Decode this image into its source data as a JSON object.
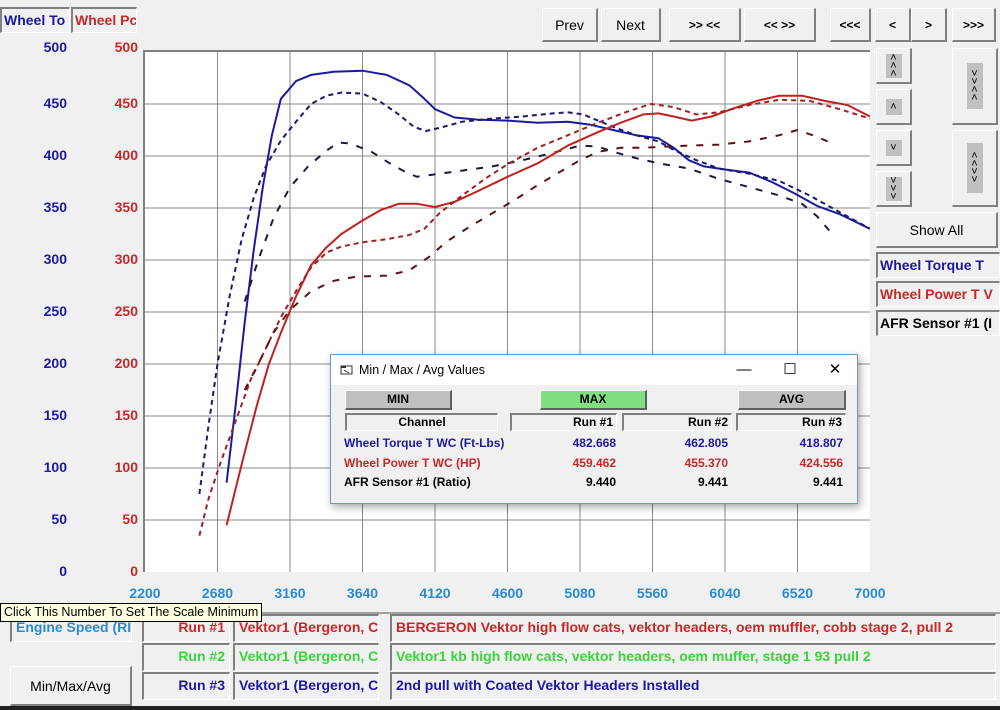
{
  "top_tabs": {
    "torque_channel": "Wheel To",
    "power_channel": "Wheel Pc"
  },
  "nav_buttons": {
    "prev": "Prev",
    "next": "Next",
    "zoom_in": ">> <<",
    "zoom_out": "<< >>",
    "first": "<<<",
    "back": "<",
    "forward": ">",
    "last": ">>>"
  },
  "side_controls": {
    "scroll_up_fast": "scroll-up-fast",
    "scroll_up": "scroll-up",
    "scroll_down": "scroll-down",
    "scroll_down_fast": "scroll-down-fast",
    "expand": "expand-vertical",
    "compress": "compress-vertical",
    "show_all": "Show All"
  },
  "legend": [
    {
      "label": "Wheel Torque T",
      "color": "#1a1aa0"
    },
    {
      "label": "Wheel Power T V",
      "color": "#c82828"
    },
    {
      "label": "AFR Sensor #1 (I",
      "color": "#000000"
    }
  ],
  "tooltip": "Click This Number To Set The Scale Minimum",
  "x_channel": "Engine Speed (RI",
  "runs": [
    {
      "label": "Run #1",
      "file": "Vektor1 (Bergeron, C",
      "notes": "BERGERON Vektor high flow cats, vektor headers, oem muffler, cobb stage 2, pull 2",
      "color": "#c82828"
    },
    {
      "label": "Run #2",
      "file": "Vektor1 (Bergeron, C",
      "notes": "Vektor1 kb high flow cats, vektor headers, oem muffer, stage 1 93 pull 2",
      "color": "#3ad43a"
    },
    {
      "label": "Run #3",
      "file": "Vektor1 (Bergeron, C",
      "notes": "2nd pull with Coated Vektor Headers Installed",
      "color": "#1a1aa0"
    }
  ],
  "minmax_button": "Min/Max/Avg",
  "dialog": {
    "title": "Min / Max / Avg Values",
    "buttons": {
      "min": "MIN",
      "max": "MAX",
      "avg": "AVG"
    },
    "active": "MAX",
    "headers": [
      "Channel",
      "Run #1",
      "Run #2",
      "Run #3"
    ],
    "rows": [
      {
        "channel": "Wheel Torque T WC (Ft-Lbs)",
        "values": [
          "482.668",
          "462.805",
          "418.807"
        ],
        "color": "#1a1aa0"
      },
      {
        "channel": "Wheel Power T WC (HP)",
        "values": [
          "459.462",
          "455.370",
          "424.556"
        ],
        "color": "#c82828"
      },
      {
        "channel": "AFR Sensor #1 (Ratio)",
        "values": [
          "9.440",
          "9.441",
          "9.441"
        ],
        "color": "#000000"
      }
    ]
  },
  "chart_data": {
    "type": "line",
    "title": "",
    "xlabel": "Engine Speed (RPM)",
    "ylabel_left": "Wheel Torque T WC (Ft-Lbs)",
    "ylabel_right": "Wheel Power T WC (HP)",
    "xlim": [
      2200,
      7000
    ],
    "ylim": [
      0,
      500
    ],
    "x_ticks": [
      "2200",
      "2680",
      "3160",
      "3640",
      "4120",
      "4600",
      "5080",
      "5560",
      "6040",
      "6520",
      "7000"
    ],
    "y_ticks_torque": [
      "500",
      "450",
      "400",
      "350",
      "300",
      "250",
      "200",
      "150",
      "100",
      "50",
      "0"
    ],
    "y_ticks_power": [
      "500",
      "450",
      "400",
      "350",
      "300",
      "250",
      "200",
      "150",
      "100",
      "50",
      "0"
    ],
    "grid": true,
    "series": [
      {
        "name": "Wheel Torque Run #1",
        "color": "#1a1aa0",
        "style": "solid",
        "points": [
          [
            2740,
            86
          ],
          [
            2800,
            160
          ],
          [
            2860,
            240
          ],
          [
            2920,
            310
          ],
          [
            2980,
            370
          ],
          [
            3040,
            420
          ],
          [
            3100,
            455
          ],
          [
            3200,
            472
          ],
          [
            3300,
            478
          ],
          [
            3450,
            481
          ],
          [
            3640,
            482
          ],
          [
            3800,
            478
          ],
          [
            3950,
            468
          ],
          [
            4050,
            455
          ],
          [
            4120,
            445
          ],
          [
            4250,
            437
          ],
          [
            4400,
            435
          ],
          [
            4600,
            434
          ],
          [
            4800,
            432
          ],
          [
            5000,
            433
          ],
          [
            5150,
            430
          ],
          [
            5300,
            425
          ],
          [
            5450,
            420
          ],
          [
            5600,
            417
          ],
          [
            5700,
            408
          ],
          [
            5800,
            396
          ],
          [
            5900,
            390
          ],
          [
            6040,
            387
          ],
          [
            6200,
            384
          ],
          [
            6350,
            375
          ],
          [
            6500,
            364
          ],
          [
            6650,
            352
          ],
          [
            6800,
            344
          ],
          [
            6900,
            337
          ],
          [
            7000,
            330
          ]
        ]
      },
      {
        "name": "Wheel Torque Run #2",
        "color": "#1a1a70",
        "style": "dashed",
        "points": [
          [
            2560,
            75
          ],
          [
            2620,
            140
          ],
          [
            2680,
            200
          ],
          [
            2760,
            265
          ],
          [
            2840,
            320
          ],
          [
            2920,
            360
          ],
          [
            3000,
            390
          ],
          [
            3100,
            415
          ],
          [
            3200,
            433
          ],
          [
            3300,
            450
          ],
          [
            3400,
            458
          ],
          [
            3500,
            461
          ],
          [
            3640,
            460
          ],
          [
            3760,
            452
          ],
          [
            3880,
            440
          ],
          [
            3980,
            428
          ],
          [
            4060,
            424
          ],
          [
            4150,
            427
          ],
          [
            4300,
            433
          ],
          [
            4500,
            436
          ],
          [
            4700,
            438
          ],
          [
            4900,
            441
          ],
          [
            5000,
            442
          ],
          [
            5100,
            440
          ],
          [
            5200,
            434
          ],
          [
            5300,
            428
          ],
          [
            5450,
            420
          ],
          [
            5600,
            414
          ],
          [
            5700,
            406
          ],
          [
            5850,
            396
          ],
          [
            6000,
            388
          ],
          [
            6200,
            383
          ],
          [
            6400,
            376
          ],
          [
            6600,
            362
          ],
          [
            6800,
            346
          ],
          [
            7000,
            330
          ]
        ]
      },
      {
        "name": "Wheel Torque Run #3",
        "color": "#1a1a40",
        "style": "dashed",
        "points": [
          [
            2860,
            260
          ],
          [
            2950,
            300
          ],
          [
            3050,
            340
          ],
          [
            3160,
            370
          ],
          [
            3280,
            390
          ],
          [
            3400,
            405
          ],
          [
            3480,
            413
          ],
          [
            3560,
            412
          ],
          [
            3700,
            404
          ],
          [
            3820,
            393
          ],
          [
            3920,
            385
          ],
          [
            4000,
            380
          ],
          [
            4150,
            383
          ],
          [
            4300,
            386
          ],
          [
            4500,
            390
          ],
          [
            4700,
            396
          ],
          [
            4900,
            403
          ],
          [
            5080,
            410
          ],
          [
            5200,
            409
          ],
          [
            5300,
            404
          ],
          [
            5450,
            398
          ],
          [
            5600,
            393
          ],
          [
            5800,
            388
          ],
          [
            6000,
            378
          ],
          [
            6200,
            370
          ],
          [
            6400,
            362
          ],
          [
            6550,
            354
          ],
          [
            6650,
            342
          ],
          [
            6750,
            325
          ]
        ]
      },
      {
        "name": "Wheel Power Run #1",
        "color": "#c02020",
        "style": "solid",
        "points": [
          [
            2740,
            45
          ],
          [
            2800,
            80
          ],
          [
            2860,
            115
          ],
          [
            2940,
            160
          ],
          [
            3020,
            200
          ],
          [
            3100,
            230
          ],
          [
            3200,
            265
          ],
          [
            3300,
            295
          ],
          [
            3400,
            312
          ],
          [
            3500,
            325
          ],
          [
            3640,
            338
          ],
          [
            3760,
            348
          ],
          [
            3880,
            354
          ],
          [
            4000,
            354
          ],
          [
            4120,
            351
          ],
          [
            4250,
            356
          ],
          [
            4400,
            366
          ],
          [
            4600,
            380
          ],
          [
            4800,
            393
          ],
          [
            5000,
            410
          ],
          [
            5200,
            423
          ],
          [
            5350,
            432
          ],
          [
            5500,
            440
          ],
          [
            5600,
            441
          ],
          [
            5700,
            438
          ],
          [
            5820,
            434
          ],
          [
            5950,
            438
          ],
          [
            6100,
            446
          ],
          [
            6250,
            453
          ],
          [
            6400,
            458
          ],
          [
            6550,
            458
          ],
          [
            6700,
            453
          ],
          [
            6850,
            449
          ],
          [
            7000,
            438
          ]
        ]
      },
      {
        "name": "Wheel Power Run #2",
        "color": "#a02020",
        "style": "dashed",
        "points": [
          [
            2560,
            35
          ],
          [
            2620,
            70
          ],
          [
            2700,
            105
          ],
          [
            2800,
            145
          ],
          [
            2900,
            185
          ],
          [
            3000,
            215
          ],
          [
            3100,
            245
          ],
          [
            3200,
            270
          ],
          [
            3300,
            293
          ],
          [
            3400,
            307
          ],
          [
            3500,
            313
          ],
          [
            3640,
            317
          ],
          [
            3800,
            320
          ],
          [
            3950,
            324
          ],
          [
            4050,
            330
          ],
          [
            4150,
            345
          ],
          [
            4300,
            362
          ],
          [
            4450,
            378
          ],
          [
            4600,
            392
          ],
          [
            4800,
            408
          ],
          [
            5000,
            420
          ],
          [
            5200,
            432
          ],
          [
            5400,
            443
          ],
          [
            5550,
            450
          ],
          [
            5700,
            447
          ],
          [
            5850,
            440
          ],
          [
            6000,
            442
          ],
          [
            6200,
            449
          ],
          [
            6400,
            454
          ],
          [
            6600,
            453
          ],
          [
            6800,
            445
          ],
          [
            7000,
            436
          ]
        ]
      },
      {
        "name": "Wheel Power Run #3",
        "color": "#601010",
        "style": "dashed",
        "points": [
          [
            2860,
            175
          ],
          [
            2950,
            200
          ],
          [
            3050,
            230
          ],
          [
            3160,
            252
          ],
          [
            3300,
            270
          ],
          [
            3450,
            280
          ],
          [
            3600,
            284
          ],
          [
            3800,
            285
          ],
          [
            3950,
            290
          ],
          [
            4080,
            303
          ],
          [
            4200,
            318
          ],
          [
            4350,
            332
          ],
          [
            4500,
            345
          ],
          [
            4650,
            358
          ],
          [
            4800,
            372
          ],
          [
            4950,
            385
          ],
          [
            5080,
            396
          ],
          [
            5200,
            404
          ],
          [
            5350,
            408
          ],
          [
            5500,
            408
          ],
          [
            5650,
            409
          ],
          [
            5800,
            410
          ],
          [
            6000,
            411
          ],
          [
            6200,
            414
          ],
          [
            6400,
            420
          ],
          [
            6520,
            425
          ],
          [
            6620,
            420
          ],
          [
            6720,
            414
          ]
        ]
      }
    ]
  }
}
